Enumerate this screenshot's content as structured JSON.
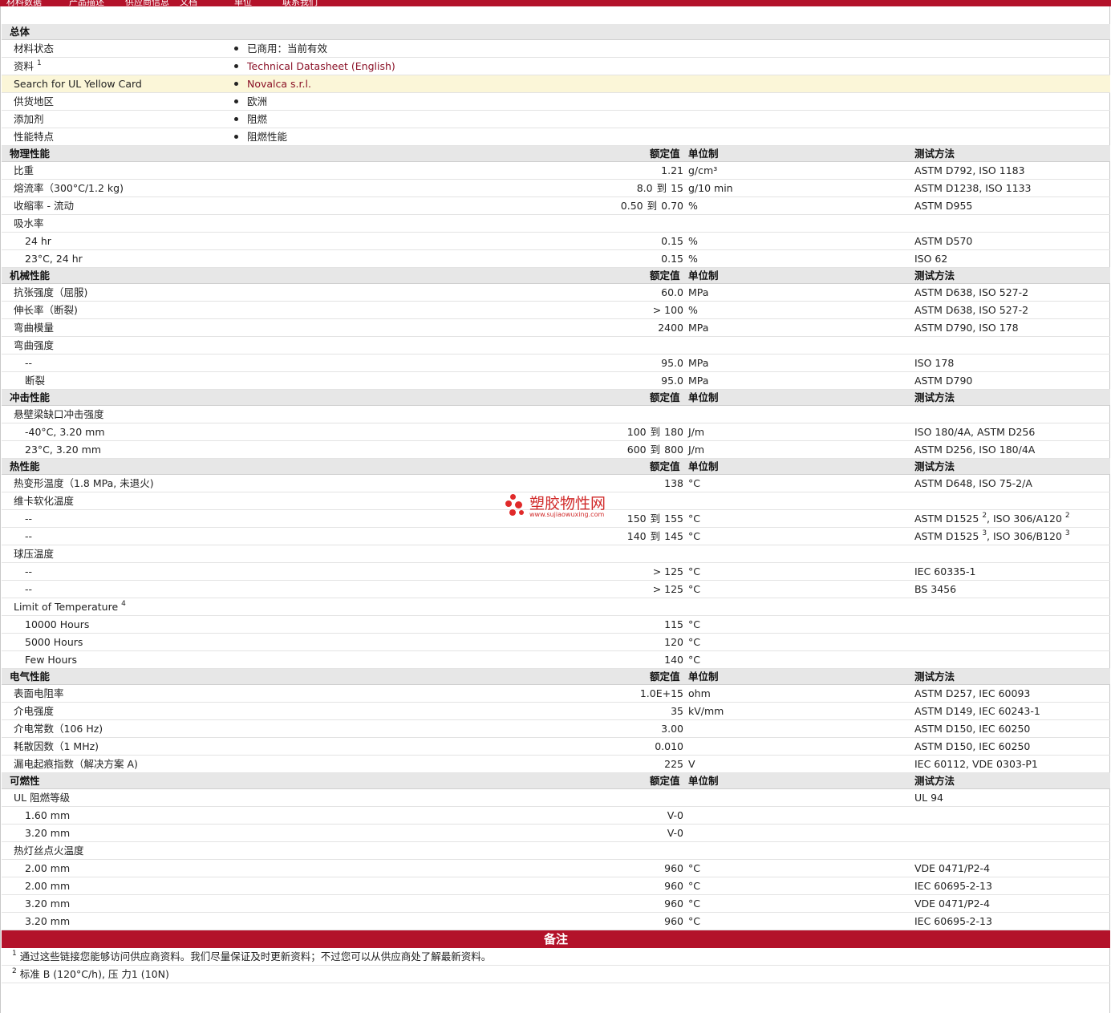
{
  "header": {
    "fragments": [
      "材料数据",
      "产品描述",
      "供应商信息",
      "文档",
      "单位",
      "联系我们"
    ]
  },
  "general": {
    "title": "总体",
    "rows": [
      {
        "label": "材料状态",
        "value": "已商用：当前有效"
      },
      {
        "label": "资料",
        "sup": "1",
        "value": "Technical Datasheet (English)",
        "link": true
      },
      {
        "label": "Search for UL Yellow Card",
        "value": "Novalca s.r.l.",
        "link": true,
        "highlight": true
      },
      {
        "label": "供货地区",
        "value": "欧洲"
      },
      {
        "label": "添加剂",
        "value": "阻燃"
      },
      {
        "label": "性能特点",
        "value": "阻燃性能"
      }
    ]
  },
  "column_headers": {
    "nominal": "额定值",
    "unit": "单位制",
    "method": "测试方法"
  },
  "sections": [
    {
      "title": "物理性能",
      "rows": [
        {
          "label": "比重",
          "v1": "1.21",
          "unit": "g/cm³",
          "method": "ASTM D792, ISO 1183"
        },
        {
          "label": "熔流率（300°C/1.2 kg)",
          "v1": "8.0",
          "to": "到",
          "v2": "15",
          "unit": "g/10 min",
          "method": "ASTM D1238, ISO 1133"
        },
        {
          "label": "收缩率 - 流动",
          "v1": "0.50",
          "to": "到",
          "v2": "0.70",
          "unit": "%",
          "method": "ASTM D955"
        },
        {
          "label": "吸水率"
        },
        {
          "label": "24 hr",
          "sub": true,
          "v1": "0.15",
          "unit": "%",
          "method": "ASTM D570"
        },
        {
          "label": "23°C, 24 hr",
          "sub": true,
          "v1": "0.15",
          "unit": "%",
          "method": "ISO 62"
        }
      ]
    },
    {
      "title": "机械性能",
      "rows": [
        {
          "label": "抗张强度（屈服)",
          "v1": "60.0",
          "unit": "MPa",
          "method": "ASTM D638, ISO 527-2"
        },
        {
          "label": "伸长率（断裂)",
          "v1": "> 100",
          "unit": "%",
          "method": "ASTM D638, ISO 527-2"
        },
        {
          "label": "弯曲模量",
          "v1": "2400",
          "unit": "MPa",
          "method": "ASTM D790, ISO 178"
        },
        {
          "label": "弯曲强度"
        },
        {
          "label": "--",
          "sub": true,
          "v1": "95.0",
          "unit": "MPa",
          "method": "ISO 178"
        },
        {
          "label": "断裂",
          "sub": true,
          "v1": "95.0",
          "unit": "MPa",
          "method": "ASTM D790"
        }
      ]
    },
    {
      "title": "冲击性能",
      "rows": [
        {
          "label": "悬壁梁缺口冲击强度"
        },
        {
          "label": "-40°C, 3.20 mm",
          "sub": true,
          "v1": "100",
          "to": "到",
          "v2": "180",
          "unit": "J/m",
          "method": "ISO 180/4A, ASTM D256"
        },
        {
          "label": "23°C, 3.20 mm",
          "sub": true,
          "v1": "600",
          "to": "到",
          "v2": "800",
          "unit": "J/m",
          "method": "ASTM D256, ISO 180/4A"
        }
      ]
    },
    {
      "title": "热性能",
      "rows": [
        {
          "label": "热变形温度（1.8 MPa, 未退火)",
          "v1": "138",
          "unit": "°C",
          "method": "ASTM D648, ISO 75-2/A"
        },
        {
          "label": "维卡软化温度"
        },
        {
          "label": "--",
          "sub": true,
          "v1": "150",
          "to": "到",
          "v2": "155",
          "unit": "°C",
          "method": "ASTM D1525",
          "msup": "2",
          "method2": ", ISO 306/A120",
          "msup2": "2"
        },
        {
          "label": "--",
          "sub": true,
          "v1": "140",
          "to": "到",
          "v2": "145",
          "unit": "°C",
          "method": "ASTM D1525",
          "msup": "3",
          "method2": ", ISO 306/B120",
          "msup2": "3"
        },
        {
          "label": "球压温度"
        },
        {
          "label": "--",
          "sub": true,
          "v1": "> 125",
          "unit": "°C",
          "method": "IEC 60335-1"
        },
        {
          "label": "--",
          "sub": true,
          "v1": "> 125",
          "unit": "°C",
          "method": "BS 3456"
        },
        {
          "label": "Limit of Temperature",
          "lsup": "4"
        },
        {
          "label": "10000 Hours",
          "sub": true,
          "v1": "115",
          "unit": "°C"
        },
        {
          "label": "5000 Hours",
          "sub": true,
          "v1": "120",
          "unit": "°C"
        },
        {
          "label": "Few Hours",
          "sub": true,
          "v1": "140",
          "unit": "°C"
        }
      ]
    },
    {
      "title": "电气性能",
      "rows": [
        {
          "label": "表面电阻率",
          "v1": "1.0E+15",
          "unit": "ohm",
          "method": "ASTM D257, IEC 60093"
        },
        {
          "label": "介电强度",
          "v1": "35",
          "unit": "kV/mm",
          "method": "ASTM D149, IEC 60243-1"
        },
        {
          "label": "介电常数（106 Hz)",
          "v1": "3.00",
          "method": "ASTM D150, IEC 60250"
        },
        {
          "label": "耗散因数（1 MHz)",
          "v1": "0.010",
          "method": "ASTM D150, IEC 60250"
        },
        {
          "label": "漏电起痕指数（解决方案 A)",
          "v1": "225",
          "unit": "V",
          "method": "IEC 60112, VDE 0303-P1"
        }
      ]
    },
    {
      "title": "可燃性",
      "rows": [
        {
          "label": "UL 阻燃等级",
          "method": "UL 94"
        },
        {
          "label": "1.60 mm",
          "sub": true,
          "v1": "V-0"
        },
        {
          "label": "3.20 mm",
          "sub": true,
          "v1": "V-0"
        },
        {
          "label": "热灯丝点火温度"
        },
        {
          "label": "2.00 mm",
          "sub": true,
          "v1": "960",
          "unit": "°C",
          "method": "VDE 0471/P2-4"
        },
        {
          "label": "2.00 mm",
          "sub": true,
          "v1": "960",
          "unit": "°C",
          "method": "IEC 60695-2-13"
        },
        {
          "label": "3.20 mm",
          "sub": true,
          "v1": "960",
          "unit": "°C",
          "method": "VDE 0471/P2-4"
        },
        {
          "label": "3.20 mm",
          "sub": true,
          "v1": "960",
          "unit": "°C",
          "method": "IEC 60695-2-13"
        }
      ]
    }
  ],
  "notes": {
    "title": "备注",
    "items": [
      {
        "num": "1",
        "text": "通过这些链接您能够访问供应商资料。我们尽量保证及时更新资料；不过您可以从供应商处了解最新资料。"
      },
      {
        "num": "2",
        "text": "标准 B (120°C/h), 压 力1 (10N)"
      }
    ]
  },
  "watermark": {
    "text": "塑胶物性网",
    "url": "www.sujiaowuxing.com"
  },
  "colors": {
    "brand": "#b3122a",
    "section_bg": "#e7e7e7",
    "highlight_bg": "#fbf6d8",
    "link": "#8a1026"
  }
}
